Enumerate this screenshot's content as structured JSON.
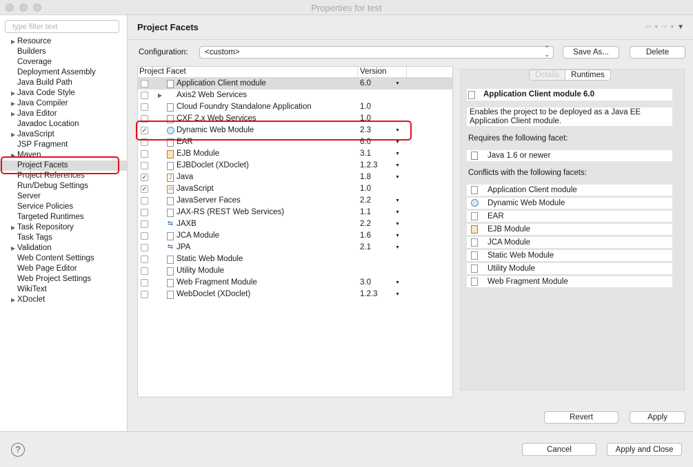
{
  "window": {
    "title": "Properties for test"
  },
  "sidebar": {
    "filter_placeholder": "type filter text",
    "items": [
      {
        "label": "Resource",
        "expandable": true
      },
      {
        "label": "Builders"
      },
      {
        "label": "Coverage"
      },
      {
        "label": "Deployment Assembly"
      },
      {
        "label": "Java Build Path"
      },
      {
        "label": "Java Code Style",
        "expandable": true
      },
      {
        "label": "Java Compiler",
        "expandable": true
      },
      {
        "label": "Java Editor",
        "expandable": true
      },
      {
        "label": "Javadoc Location"
      },
      {
        "label": "JavaScript",
        "expandable": true
      },
      {
        "label": "JSP Fragment"
      },
      {
        "label": "Maven",
        "expandable": true
      },
      {
        "label": "Project Facets",
        "selected": true
      },
      {
        "label": "Project References"
      },
      {
        "label": "Run/Debug Settings"
      },
      {
        "label": "Server"
      },
      {
        "label": "Service Policies"
      },
      {
        "label": "Targeted Runtimes"
      },
      {
        "label": "Task Repository",
        "expandable": true
      },
      {
        "label": "Task Tags"
      },
      {
        "label": "Validation",
        "expandable": true
      },
      {
        "label": "Web Content Settings"
      },
      {
        "label": "Web Page Editor"
      },
      {
        "label": "Web Project Settings"
      },
      {
        "label": "WikiText"
      },
      {
        "label": "XDoclet",
        "expandable": true
      }
    ]
  },
  "main": {
    "title": "Project Facets",
    "nav": {
      "back": "⇦ ▾",
      "forward": "⇨ ▾",
      "menu": "▼"
    },
    "configuration": {
      "label": "Configuration:",
      "value": "<custom>",
      "save_as": "Save As...",
      "delete": "Delete"
    },
    "table": {
      "headers": {
        "facet": "Project Facet",
        "version": "Version"
      },
      "rows": [
        {
          "name": "Application Client module",
          "version": "6.0",
          "checked": false,
          "dropdown": true,
          "icon": "doc",
          "selected": true
        },
        {
          "name": "Axis2 Web Services",
          "version": "",
          "checked": false,
          "dropdown": false,
          "icon": "none",
          "expandable": true
        },
        {
          "name": "Cloud Foundry Standalone Application",
          "version": "1.0",
          "checked": false,
          "dropdown": false,
          "icon": "doc"
        },
        {
          "name": "CXF 2.x Web Services",
          "version": "1.0",
          "checked": false,
          "dropdown": false,
          "icon": "doc"
        },
        {
          "name": "Dynamic Web Module",
          "version": "2.3",
          "checked": true,
          "dropdown": true,
          "icon": "web"
        },
        {
          "name": "EAR",
          "version": "6.0",
          "checked": false,
          "dropdown": true,
          "icon": "doc"
        },
        {
          "name": "EJB Module",
          "version": "3.1",
          "checked": false,
          "dropdown": true,
          "icon": "ejb"
        },
        {
          "name": "EJBDoclet (XDoclet)",
          "version": "1.2.3",
          "checked": false,
          "dropdown": true,
          "icon": "doc"
        },
        {
          "name": "Java",
          "version": "1.8",
          "checked": true,
          "dropdown": true,
          "icon": "java"
        },
        {
          "name": "JavaScript",
          "version": "1.0",
          "checked": true,
          "dropdown": false,
          "icon": "js"
        },
        {
          "name": "JavaServer Faces",
          "version": "2.2",
          "checked": false,
          "dropdown": true,
          "icon": "doc"
        },
        {
          "name": "JAX-RS (REST Web Services)",
          "version": "1.1",
          "checked": false,
          "dropdown": true,
          "icon": "doc"
        },
        {
          "name": "JAXB",
          "version": "2.2",
          "checked": false,
          "dropdown": true,
          "icon": "arrows"
        },
        {
          "name": "JCA Module",
          "version": "1.6",
          "checked": false,
          "dropdown": true,
          "icon": "doc"
        },
        {
          "name": "JPA",
          "version": "2.1",
          "checked": false,
          "dropdown": true,
          "icon": "arrows"
        },
        {
          "name": "Static Web Module",
          "version": "",
          "checked": false,
          "dropdown": false,
          "icon": "doc"
        },
        {
          "name": "Utility Module",
          "version": "",
          "checked": false,
          "dropdown": false,
          "icon": "doc"
        },
        {
          "name": "Web Fragment Module",
          "version": "3.0",
          "checked": false,
          "dropdown": true,
          "icon": "doc"
        },
        {
          "name": "WebDoclet (XDoclet)",
          "version": "1.2.3",
          "checked": false,
          "dropdown": true,
          "icon": "doc"
        }
      ]
    },
    "details": {
      "tabs": {
        "details": "Details",
        "runtimes": "Runtimes"
      },
      "title": "Application Client module 6.0",
      "description": "Enables the project to be deployed as a Java EE Application Client module.",
      "requires_label": "Requires the following facet:",
      "requires": [
        {
          "name": "Java 1.6 or newer",
          "icon": "java"
        }
      ],
      "conflicts_label": "Conflicts with the following facets:",
      "conflicts": [
        {
          "name": "Application Client module",
          "icon": "doc"
        },
        {
          "name": "Dynamic Web Module",
          "icon": "web"
        },
        {
          "name": "EAR",
          "icon": "doc"
        },
        {
          "name": "EJB Module",
          "icon": "ejb"
        },
        {
          "name": "JCA Module",
          "icon": "doc"
        },
        {
          "name": "Static Web Module",
          "icon": "doc"
        },
        {
          "name": "Utility Module",
          "icon": "doc"
        },
        {
          "name": "Web Fragment Module",
          "icon": "doc"
        }
      ]
    },
    "revert": "Revert",
    "apply": "Apply"
  },
  "footer": {
    "help": "?",
    "cancel": "Cancel",
    "apply_close": "Apply and Close"
  },
  "colors": {
    "highlight": "#e0101e",
    "selection": "#dcdcdc"
  }
}
